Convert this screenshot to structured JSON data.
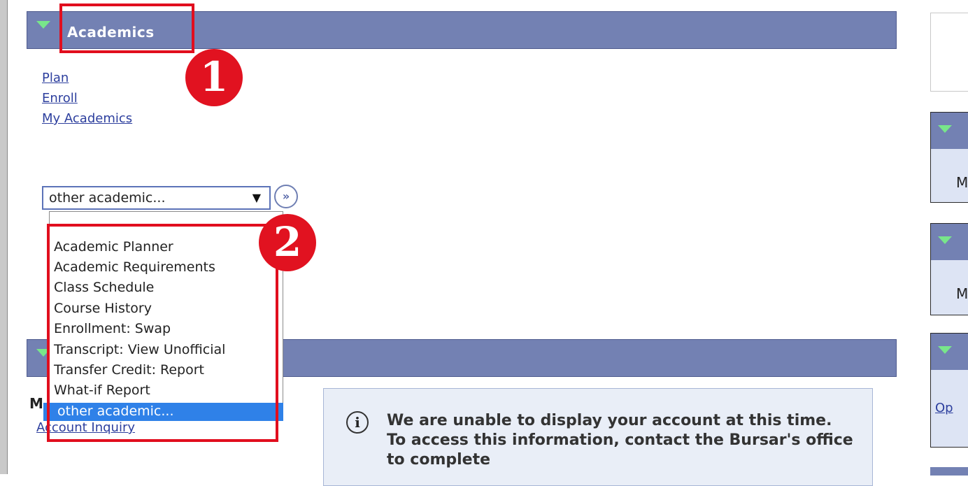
{
  "academics": {
    "title": "Academics",
    "links": [
      "Plan",
      "Enroll",
      "My Academics"
    ],
    "select": {
      "value": "other academic...",
      "go_label": "»",
      "options": [
        "Academic Planner",
        "Academic Requirements",
        "Class Schedule",
        "Course History",
        "Enrollment: Swap",
        "Transcript: View Unofficial",
        "Transfer Credit: Report",
        "What-if Report",
        "other academic..."
      ]
    }
  },
  "finances": {
    "heading_fragment": "M",
    "account_link": "Account Inquiry",
    "info_message": "We are unable to display your account at this time.  To access this information, contact the Bursar's office to complete"
  },
  "markers": [
    "1",
    "2"
  ],
  "right_panel": {
    "letters": [
      "M",
      "M"
    ],
    "link": "Op"
  },
  "colors": {
    "header_bar": "#7381b3",
    "header_triangle": "#78e68a",
    "link": "#2d3f9e",
    "selected_option": "#2f81e8",
    "annotation_red": "#e10e1e"
  }
}
